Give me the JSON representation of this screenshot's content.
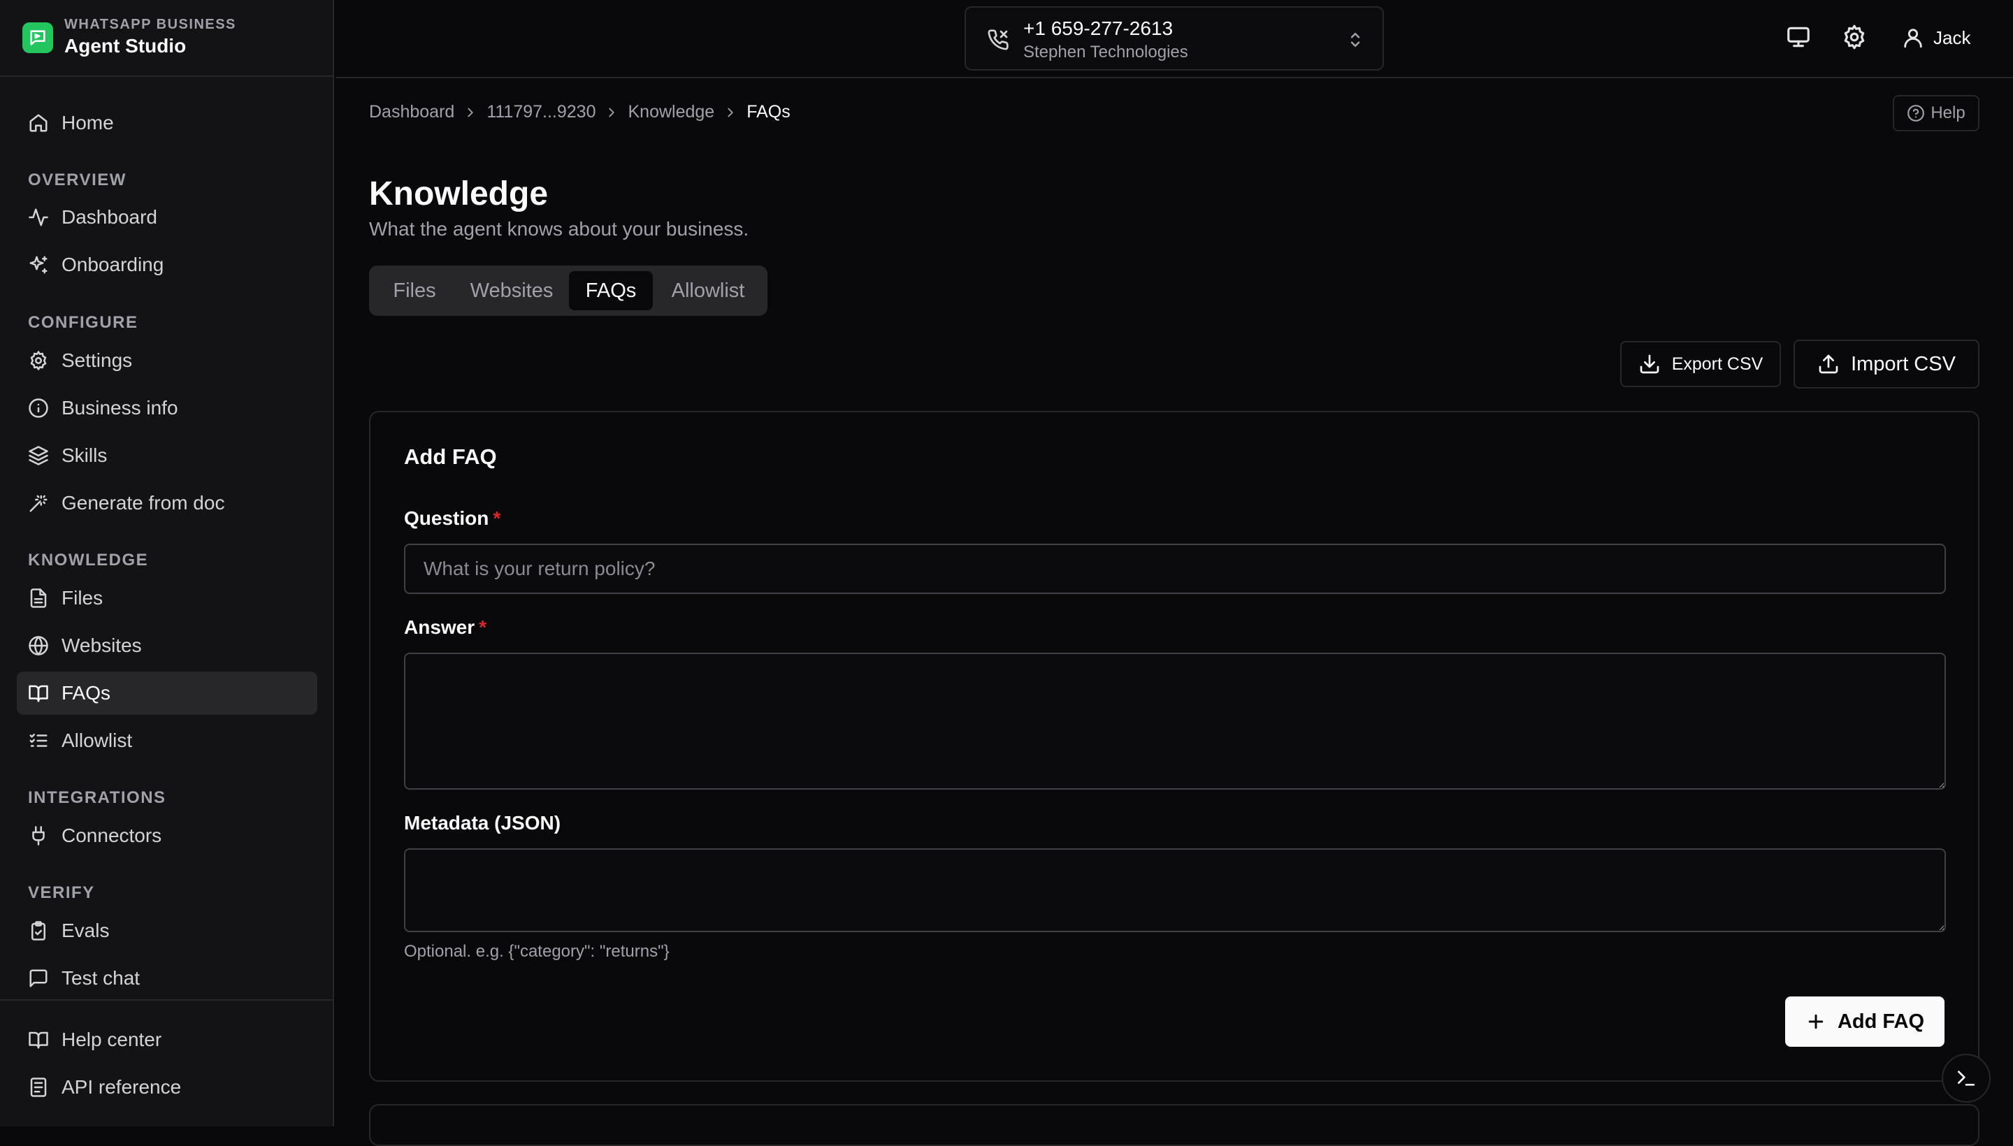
{
  "brand": {
    "kicker": "WHATSAPP BUSINESS",
    "name": "Agent Studio",
    "logo_icon": "whatsapp-chat-icon"
  },
  "sidebar": {
    "home": {
      "label": "Home",
      "icon": "home-icon"
    },
    "sections": {
      "overview": "OVERVIEW",
      "configure": "CONFIGURE",
      "knowledge": "KNOWLEDGE",
      "integrations": "INTEGRATIONS",
      "verify": "VERIFY"
    },
    "items": {
      "dashboard": "Dashboard",
      "onboarding": "Onboarding",
      "settings": "Settings",
      "business_info": "Business info",
      "skills": "Skills",
      "generate_from_doc": "Generate from doc",
      "files": "Files",
      "websites": "Websites",
      "faqs": "FAQs",
      "allowlist": "Allowlist",
      "connectors": "Connectors",
      "evals": "Evals",
      "test_chat": "Test chat",
      "help_center": "Help center",
      "api_reference": "API reference"
    },
    "active_item": "faqs"
  },
  "header": {
    "phone_number": "+1 659-277-2613",
    "organization": "Stephen Technologies",
    "user_name": "Jack"
  },
  "breadcrumb": [
    "Dashboard",
    "111797...9230",
    "Knowledge",
    "FAQs"
  ],
  "help_label": "Help",
  "page": {
    "title": "Knowledge",
    "subtitle": "What the agent knows about your business."
  },
  "tabs": [
    "Files",
    "Websites",
    "FAQs",
    "Allowlist"
  ],
  "active_tab": "FAQs",
  "actions": {
    "export_csv": "Export CSV",
    "import_csv": "Import CSV"
  },
  "form": {
    "title": "Add FAQ",
    "question_label": "Question",
    "question_placeholder": "What is your return policy?",
    "question_value": "",
    "answer_label": "Answer",
    "answer_value": "",
    "metadata_label": "Metadata (JSON)",
    "metadata_value": "",
    "metadata_hint": "Optional. e.g. {\"category\": \"returns\"}",
    "required_mark": "*",
    "submit_label": "Add FAQ"
  },
  "colors": {
    "background": "#09090b",
    "sidebar": "#131316",
    "border": "#27272a",
    "required": "#dc2626",
    "brand": "#22c55e"
  }
}
